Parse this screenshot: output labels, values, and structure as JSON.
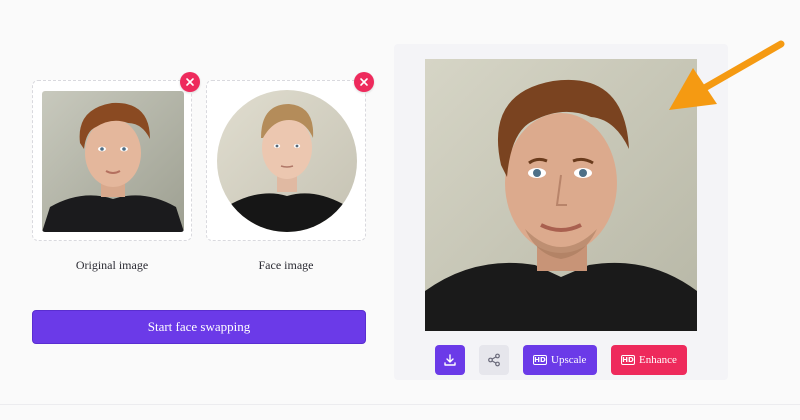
{
  "upload": {
    "original": {
      "caption": "Original image",
      "remove_icon": "close-icon"
    },
    "face": {
      "caption": "Face image",
      "remove_icon": "close-icon"
    },
    "start_button_label": "Start face swapping"
  },
  "result": {
    "actions": {
      "download_icon": "download-icon",
      "share_icon": "share-icon",
      "upscale_label": "Upscale",
      "enhance_label": "Enhance",
      "hd_badge": "HD"
    }
  },
  "colors": {
    "primary": "#6b3ae8",
    "danger": "#ee2a5c",
    "annotation_arrow": "#f59a12",
    "share_button_bg": "#e6e6ec",
    "panel_bg": "#f4f4f7"
  }
}
